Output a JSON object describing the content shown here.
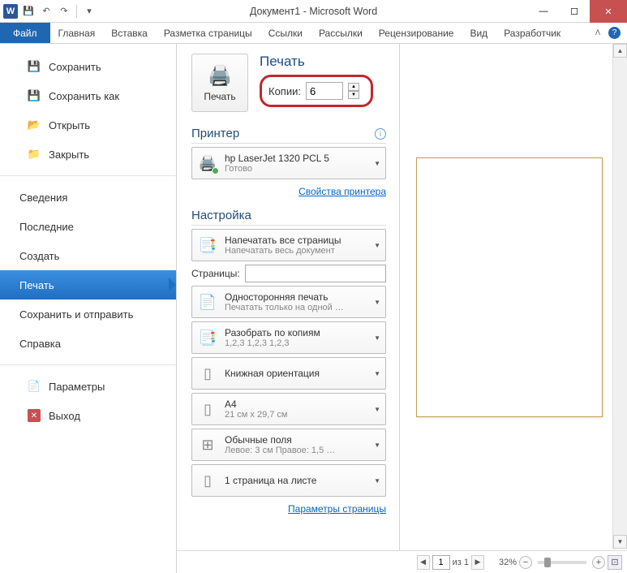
{
  "title": "Документ1 - Microsoft Word",
  "qat": {
    "word": "W"
  },
  "ribbon": {
    "file": "Файл",
    "tabs": [
      "Главная",
      "Вставка",
      "Разметка страницы",
      "Ссылки",
      "Рассылки",
      "Рецензирование",
      "Вид",
      "Разработчик"
    ]
  },
  "sidebar": {
    "save": "Сохранить",
    "saveas": "Сохранить как",
    "open": "Открыть",
    "close": "Закрыть",
    "info": "Сведения",
    "recent": "Последние",
    "new": "Создать",
    "print": "Печать",
    "share": "Сохранить и отправить",
    "help": "Справка",
    "options": "Параметры",
    "exit": "Выход"
  },
  "print_section": {
    "heading": "Печать",
    "print_btn": "Печать",
    "copies_label": "Копии:",
    "copies_value": "6"
  },
  "printer_section": {
    "heading": "Принтер",
    "name": "hp LaserJet 1320 PCL 5",
    "status": "Готово",
    "props_link": "Свойства принтера"
  },
  "settings_section": {
    "heading": "Настройка",
    "range": {
      "main": "Напечатать все страницы",
      "sub": "Напечатать весь документ"
    },
    "pages_label": "Страницы:",
    "sided": {
      "main": "Односторонняя печать",
      "sub": "Печатать только на одной …"
    },
    "collate": {
      "main": "Разобрать по копиям",
      "sub": "1,2,3   1,2,3   1,2,3"
    },
    "orient": {
      "main": "Книжная ориентация"
    },
    "paper": {
      "main": "A4",
      "sub": "21 см x 29,7 см"
    },
    "margins": {
      "main": "Обычные поля",
      "sub": "Левое:  3 см   Правое:  1,5 …"
    },
    "ppp": {
      "main": "1 страница на листе"
    },
    "page_setup_link": "Параметры страницы"
  },
  "status_bar": {
    "page": "1",
    "of_label": "из 1",
    "zoom": "32%"
  }
}
